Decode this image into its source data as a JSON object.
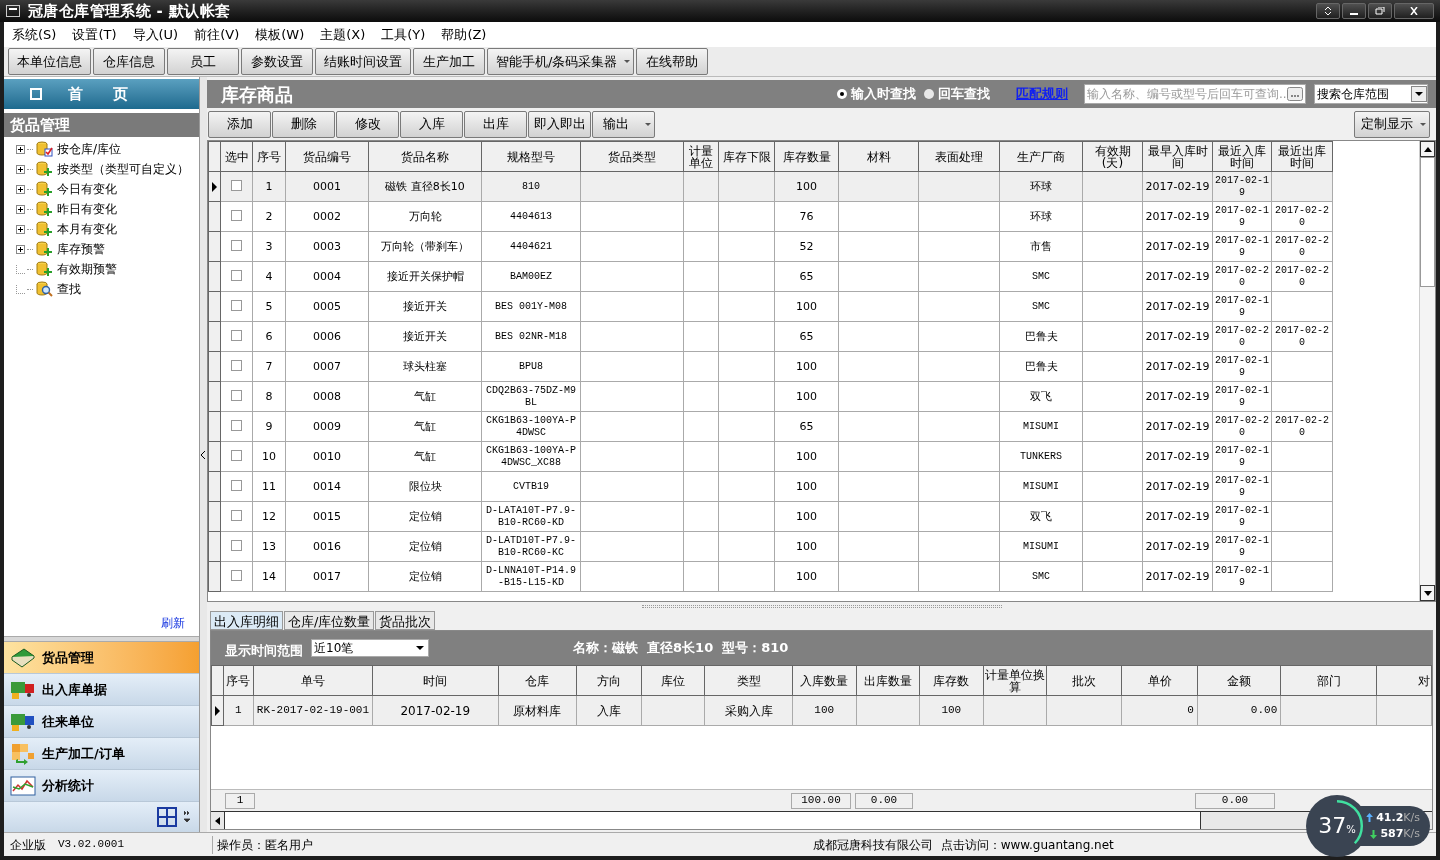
{
  "window": {
    "title": "冠唐仓库管理系统 - 默认帐套"
  },
  "menu": [
    "系统(S)",
    "设置(T)",
    "导入(U)",
    "前往(V)",
    "模板(W)",
    "主题(X)",
    "工具(Y)",
    "帮助(Z)"
  ],
  "toolbar": [
    {
      "label": "本单位信息",
      "dropdown": false
    },
    {
      "label": "仓库信息",
      "dropdown": false
    },
    {
      "label": "员工",
      "dropdown": false
    },
    {
      "label": "参数设置",
      "dropdown": false
    },
    {
      "label": "结账时间设置",
      "dropdown": false
    },
    {
      "label": "生产加工",
      "dropdown": false
    },
    {
      "label": "智能手机/条码采集器",
      "dropdown": true
    },
    {
      "label": "在线帮助",
      "dropdown": false
    }
  ],
  "sidebar": {
    "home": "首　　页",
    "section": "货品管理",
    "tree": [
      {
        "label": "按仓库/库位",
        "expandable": true,
        "kind": "check"
      },
      {
        "label": "按类型（类型可自定义）",
        "expandable": true,
        "kind": "plus"
      },
      {
        "label": "今日有变化",
        "expandable": true,
        "kind": "plus"
      },
      {
        "label": "昨日有变化",
        "expandable": true,
        "kind": "plus"
      },
      {
        "label": "本月有变化",
        "expandable": true,
        "kind": "plus"
      },
      {
        "label": "库存预警",
        "expandable": true,
        "kind": "plus"
      },
      {
        "label": "有效期预警",
        "expandable": false,
        "kind": "plus"
      },
      {
        "label": "查找",
        "expandable": false,
        "kind": "search"
      }
    ],
    "refresh": "刷新",
    "nav": [
      {
        "label": "货品管理",
        "selected": true,
        "kind": "book"
      },
      {
        "label": "出入库单据",
        "selected": false,
        "kind": "truck"
      },
      {
        "label": "往来单位",
        "selected": false,
        "kind": "van"
      },
      {
        "label": "生产加工/订单",
        "selected": false,
        "kind": "blocks"
      },
      {
        "label": "分析统计",
        "selected": false,
        "kind": "chart"
      }
    ]
  },
  "content": {
    "title": "库存商品",
    "search_modes": [
      {
        "label": "输入时查找",
        "selected": true
      },
      {
        "label": "回车查找",
        "selected": false
      }
    ],
    "match_rule": "匹配规则",
    "search": {
      "placeholder": "输入名称、编号或型号后回车可查询.."
    },
    "scope": "搜索仓库范围",
    "actions": [
      {
        "label": "添加",
        "dropdown": false
      },
      {
        "label": "删除",
        "dropdown": false
      },
      {
        "label": "修改",
        "dropdown": false
      },
      {
        "label": "入库",
        "dropdown": false
      },
      {
        "label": "出库",
        "dropdown": false
      },
      {
        "label": "即入即出",
        "dropdown": false
      },
      {
        "label": "输出",
        "dropdown": true
      }
    ],
    "custom_display": "定制显示",
    "table": {
      "columns": [
        "选中",
        "序号",
        "货品编号",
        "货品名称",
        "规格型号",
        "货品类型",
        "计量单位",
        "库存下限",
        "库存数量",
        "材料",
        "表面处理",
        "生产厂商",
        "有效期(天)",
        "最早入库时间",
        "最近入库时间",
        "最近出库时间"
      ],
      "rows": [
        {
          "selected": true,
          "checked": false,
          "seq": "1",
          "code": "0001",
          "name": "磁铁  直径8长10",
          "spec": "810",
          "stock": "100",
          "maker": "环球",
          "earliest_in": "2017-02-19",
          "last_in": "2017-02-19"
        },
        {
          "selected": false,
          "checked": false,
          "seq": "2",
          "code": "0002",
          "name": "万向轮",
          "spec": "4404613",
          "stock": "76",
          "maker": "环球",
          "earliest_in": "2017-02-19",
          "last_in": "2017-02-19",
          "last_out": "2017-02-20"
        },
        {
          "selected": false,
          "checked": false,
          "seq": "3",
          "code": "0003",
          "name": "万向轮（带刹车）",
          "spec": "4404621",
          "stock": "52",
          "maker": "市售",
          "earliest_in": "2017-02-19",
          "last_in": "2017-02-19",
          "last_out": "2017-02-20"
        },
        {
          "selected": false,
          "checked": false,
          "seq": "4",
          "code": "0004",
          "name": "接近开关保护帽",
          "spec": "BAM00EZ",
          "stock": "65",
          "maker": "SMC",
          "earliest_in": "2017-02-19",
          "last_in": "2017-02-20",
          "last_out": "2017-02-20"
        },
        {
          "selected": false,
          "checked": false,
          "seq": "5",
          "code": "0005",
          "name": "接近开关",
          "spec": "BES 001Y-M08",
          "stock": "100",
          "maker": "SMC",
          "earliest_in": "2017-02-19",
          "last_in": "2017-02-19"
        },
        {
          "selected": false,
          "checked": false,
          "seq": "6",
          "code": "0006",
          "name": "接近开关",
          "spec": "BES 02NR-M18",
          "stock": "65",
          "maker": "巴鲁夫",
          "earliest_in": "2017-02-19",
          "last_in": "2017-02-20",
          "last_out": "2017-02-20"
        },
        {
          "selected": false,
          "checked": false,
          "seq": "7",
          "code": "0007",
          "name": "球头柱塞",
          "spec": "BPU8",
          "stock": "100",
          "maker": "巴鲁夫",
          "earliest_in": "2017-02-19",
          "last_in": "2017-02-19"
        },
        {
          "selected": false,
          "checked": false,
          "seq": "8",
          "code": "0008",
          "name": "气缸",
          "spec": "CDQ2B63-75DZ-M9BL",
          "stock": "100",
          "maker": "双飞",
          "earliest_in": "2017-02-19",
          "last_in": "2017-02-19"
        },
        {
          "selected": false,
          "checked": false,
          "seq": "9",
          "code": "0009",
          "name": "气缸",
          "spec": "CKG1B63-100YA-P4DWSC",
          "stock": "65",
          "maker": "MISUMI",
          "earliest_in": "2017-02-19",
          "last_in": "2017-02-20",
          "last_out": "2017-02-20"
        },
        {
          "selected": false,
          "checked": false,
          "seq": "10",
          "code": "0010",
          "name": "气缸",
          "spec": "CKG1B63-100YA-P4DWSC_XC88",
          "stock": "100",
          "maker": "TUNKERS",
          "earliest_in": "2017-02-19",
          "last_in": "2017-02-19"
        },
        {
          "selected": false,
          "checked": false,
          "seq": "11",
          "code": "0014",
          "name": "限位块",
          "spec": "CVTB19",
          "stock": "100",
          "maker": "MISUMI",
          "earliest_in": "2017-02-19",
          "last_in": "2017-02-19"
        },
        {
          "selected": false,
          "checked": false,
          "seq": "12",
          "code": "0015",
          "name": "定位销",
          "spec": "D-LATA10T-P7.9-B10-RC60-KD",
          "stock": "100",
          "maker": "双飞",
          "earliest_in": "2017-02-19",
          "last_in": "2017-02-19"
        },
        {
          "selected": false,
          "checked": false,
          "seq": "13",
          "code": "0016",
          "name": "定位销",
          "spec": "D-LATD10T-P7.9-B10-RC60-KC",
          "stock": "100",
          "maker": "MISUMI",
          "earliest_in": "2017-02-19",
          "last_in": "2017-02-19"
        },
        {
          "selected": false,
          "checked": false,
          "seq": "14",
          "code": "0017",
          "name": "定位销",
          "spec": "D-LNNA10T-P14.9-B15-L15-KD",
          "stock": "100",
          "maker": "SMC",
          "earliest_in": "2017-02-19",
          "last_in": "2017-02-19"
        }
      ]
    }
  },
  "detail": {
    "tabs": [
      {
        "label": "出入库明细",
        "selected": true
      },
      {
        "label": "仓库/库位数量",
        "selected": false
      },
      {
        "label": "货品批次",
        "selected": false
      }
    ],
    "range_label": "显示时间范围",
    "range_value": "近10笔",
    "info": "名称：磁铁  直径8长10  型号：810",
    "table": {
      "columns": [
        "序号",
        "单号",
        "时间",
        "仓库",
        "方向",
        "库位",
        "类型",
        "入库数量",
        "出库数量",
        "库存数",
        "计量单位换算",
        "批次",
        "单价",
        "金额",
        "部门",
        "对"
      ],
      "rows": [
        {
          "selected": true,
          "seq": "1",
          "number": "RK-2017-02-19-001",
          "time": "2017-02-19",
          "warehouse": "原材料库",
          "direction": "入库",
          "type": "采购入库",
          "in_qty": "100",
          "stock": "100",
          "price": "0",
          "amount": "0.00"
        }
      ]
    },
    "totals": {
      "count": "1",
      "in_qty": "100.00",
      "out_qty": "0.00",
      "amount": "0.00"
    }
  },
  "status_bar": {
    "edition": "企业版",
    "version": "V3.02.0001",
    "operator": "操作员：匿名用户",
    "company": "成都冠唐科技有限公司  点击访问：www.guantang.net"
  },
  "net_monitor": {
    "level": 0.37,
    "percent": "37",
    "percent_unit": "%",
    "up": "41.2",
    "up_unit": "K/s",
    "down": "587",
    "down_unit": "K/s"
  }
}
